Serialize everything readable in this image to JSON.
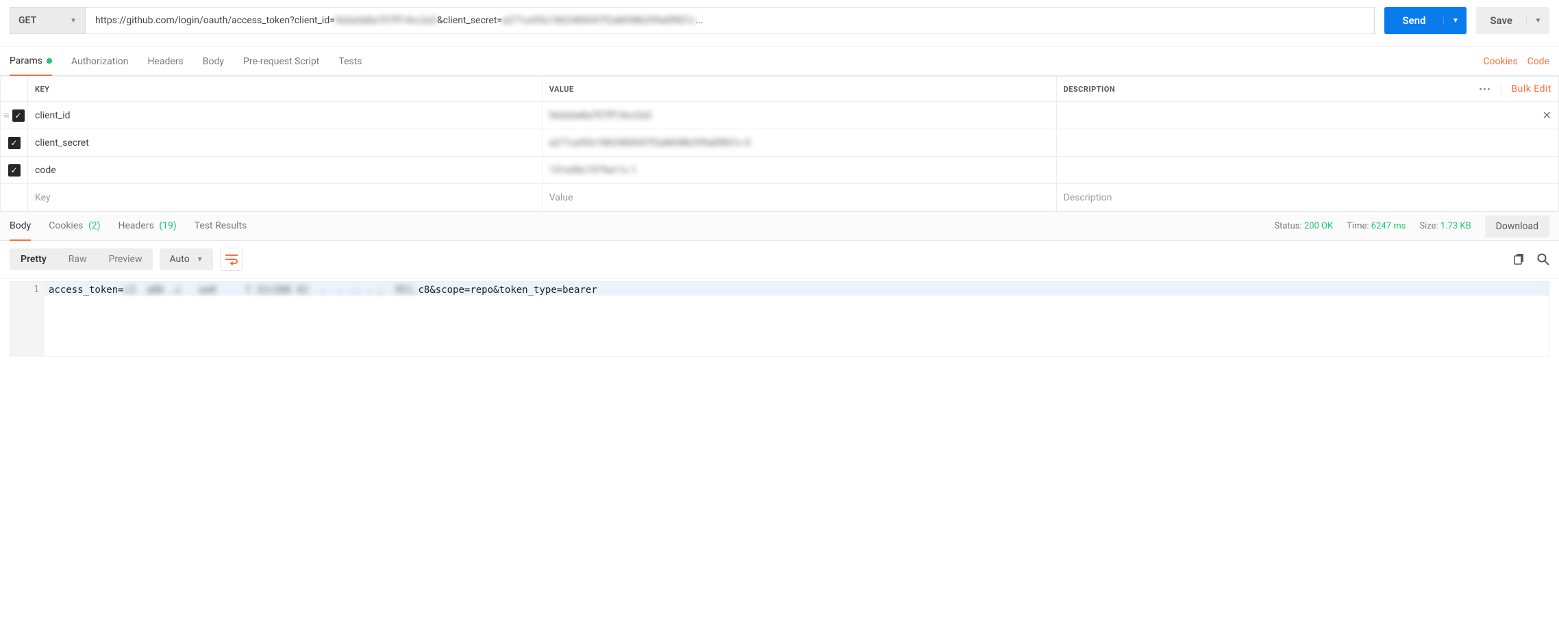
{
  "request": {
    "method": "GET",
    "url_prefix": "https://github.com/login/oauth/access_token?client_id=",
    "url_blur1": "9a3a3a8a707ff14cc2a3",
    "url_mid": "&client_secret=",
    "url_blur2": "a271ce93c1862485047f2a8698b299a0f801c",
    "url_ellipsis": " ..."
  },
  "actions": {
    "send": "Send",
    "save": "Save"
  },
  "req_tabs": {
    "params": "Params",
    "authorization": "Authorization",
    "headers": "Headers",
    "body": "Body",
    "prerequest": "Pre-request Script",
    "tests": "Tests"
  },
  "req_links": {
    "cookies": "Cookies",
    "code": "Code"
  },
  "params_header": {
    "key": "KEY",
    "value": "VALUE",
    "description": "DESCRIPTION",
    "bulk_edit": "Bulk Edit"
  },
  "params_rows": [
    {
      "key": "client_id",
      "value": "9a3a3a8a707ff14cc2a3"
    },
    {
      "key": "client_secret",
      "value": "a271ce93c1862485047f2a8698b299a0f801c  0"
    },
    {
      "key": "code",
      "value": "131e30c1979a11c  1"
    }
  ],
  "params_placeholders": {
    "key": "Key",
    "value": "Value",
    "description": "Description"
  },
  "resp_tabs": {
    "body": "Body",
    "cookies": "Cookies",
    "cookies_count": "(2)",
    "headers": "Headers",
    "headers_count": "(19)",
    "tests": "Test Results"
  },
  "resp_meta": {
    "status_label": "Status:",
    "status_value": "200 OK",
    "time_label": "Time:",
    "time_value": "6247 ms",
    "size_label": "Size:",
    "size_value": "1.73 KB",
    "download": "Download"
  },
  "body_toolbar": {
    "pretty": "Pretty",
    "raw": "Raw",
    "preview": "Preview",
    "auto": "Auto"
  },
  "code": {
    "line_no": "1",
    "prefix": "access_token=",
    "blur": "c3  a8b .c   aa0     7 31c588 62  .  . .. . ,  951.",
    "mid": "c8",
    "suffix": "&scope=repo&token_type=bearer"
  }
}
